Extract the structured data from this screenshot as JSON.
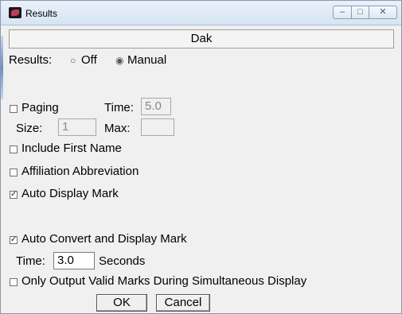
{
  "window": {
    "title": "Results",
    "minimize_glyph": "–",
    "maximize_glyph": "□",
    "close_glyph": "✕"
  },
  "header": {
    "title": "Dak"
  },
  "results_mode": {
    "label": "Results:",
    "options": [
      {
        "label": "Off",
        "selected": false
      },
      {
        "label": "Manual",
        "selected": true
      }
    ]
  },
  "paging": {
    "label": "Paging",
    "checked": false,
    "time_label": "Time:",
    "time_value": "5.0",
    "size_label": "Size:",
    "size_value": "1",
    "max_label": "Max:",
    "max_value": ""
  },
  "options": [
    {
      "label": "Include First Name",
      "checked": false
    },
    {
      "label": "Affiliation Abbreviation",
      "checked": false
    },
    {
      "label": "Auto Display Mark",
      "checked": true
    },
    {
      "label": "Auto Convert and Display Mark",
      "checked": true
    }
  ],
  "convert": {
    "time_label": "Time:",
    "time_value": "3.0",
    "units": "Seconds"
  },
  "valid_marks": {
    "label": "Only Output Valid Marks During Simultaneous Display",
    "checked": false
  },
  "buttons": {
    "ok": "OK",
    "cancel": "Cancel"
  },
  "glyphs": {
    "radio_off": "○",
    "radio_on": "◉",
    "check_on": "✓",
    "check_off": ""
  }
}
